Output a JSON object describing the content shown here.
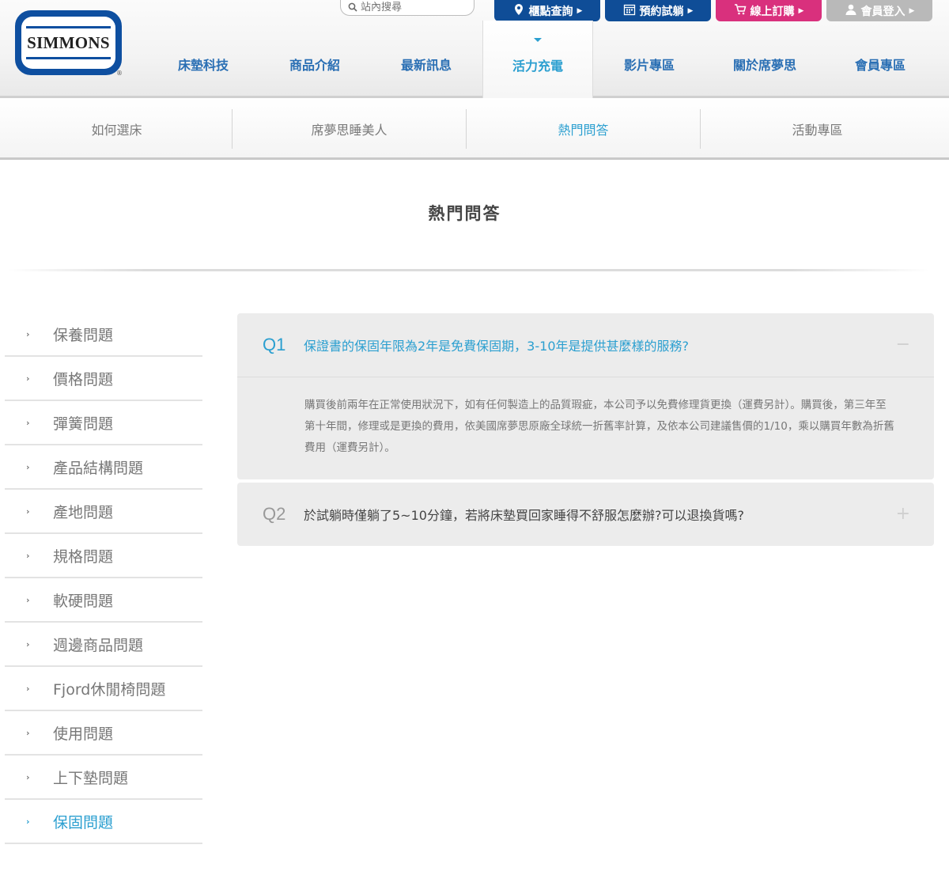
{
  "brand": {
    "logo_text": "SIMMONS",
    "logo_mark": "®"
  },
  "search": {
    "placeholder": "站內搜尋"
  },
  "top_buttons": {
    "store": "櫃點查詢",
    "book": "預約試躺",
    "shop": "線上訂購",
    "login": "會員登入"
  },
  "main_nav": [
    "床墊科技",
    "商品介紹",
    "最新訊息",
    "活力充電",
    "影片專區",
    "關於席夢思",
    "會員專區"
  ],
  "sub_nav": [
    "如何選床",
    "席夢思睡美人",
    "熱門問答",
    "活動專區"
  ],
  "page_title": "熱門問答",
  "sidebar": [
    "保養問題",
    "價格問題",
    "彈簧問題",
    "產品結構問題",
    "產地問題",
    "規格問題",
    "軟硬問題",
    "週邊商品問題",
    "Fjord休閒椅問題",
    "使用問題",
    "上下墊問題",
    "保固問題"
  ],
  "sidebar_active_index": 11,
  "faq": [
    {
      "num": "Q1",
      "question": "保證書的保固年限為2年是免費保固期，3-10年是提供甚麼樣的服務?",
      "answer": "購買後前兩年在正常使用狀況下，如有任何製造上的品質瑕疵，本公司予以免費修理貨更換（運費另計）。購買後，第三年至第十年間，修理或是更換的費用，依美國席夢思原廠全球統一折舊率計算，及依本公司建議售價的1/10，乘以購買年數為折舊費用（運費另計）。",
      "toggle": "−",
      "expanded": true
    },
    {
      "num": "Q2",
      "question": "於試躺時僅躺了5~10分鐘，若將床墊買回家睡得不舒服怎麼辦?可以退換貨嗎?",
      "toggle": "+",
      "expanded": false
    }
  ],
  "colors": {
    "brand_blue": "#0f4d97",
    "accent": "#2b9fd0",
    "shop_pink": "#d9307d",
    "login_gray": "#b9b9b9"
  }
}
